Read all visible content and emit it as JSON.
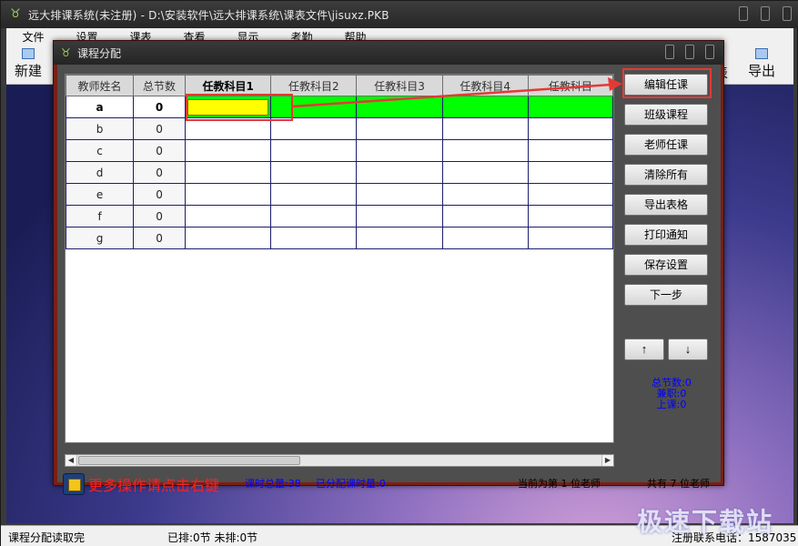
{
  "main_window": {
    "title": "远大排课系统(未注册) - D:\\安装软件\\远大排课系统\\课表文件\\jisuxz.PKB",
    "menu": [
      "文件",
      "设置",
      "课表",
      "查看",
      "显示",
      "考勤",
      "帮助"
    ],
    "toolbar": {
      "new_label": "新建",
      "table_label": "表",
      "export_label": "导出"
    }
  },
  "dialog": {
    "title": "课程分配",
    "grid": {
      "columns": [
        "教师姓名",
        "总节数",
        "任教科目1",
        "任教科目2",
        "任教科目3",
        "任教科目4",
        "任教科目"
      ],
      "rows": [
        {
          "name": "a",
          "count": "0"
        },
        {
          "name": "b",
          "count": "0"
        },
        {
          "name": "c",
          "count": "0"
        },
        {
          "name": "d",
          "count": "0"
        },
        {
          "name": "e",
          "count": "0"
        },
        {
          "name": "f",
          "count": "0"
        },
        {
          "name": "g",
          "count": "0"
        }
      ]
    },
    "buttons": [
      "编辑任课",
      "班级课程",
      "老师任课",
      "清除所有",
      "导出表格",
      "打印通知",
      "保存设置",
      "下一步"
    ],
    "arrows": {
      "up": "↑",
      "down": "↓"
    },
    "stats": {
      "total": "总节数:0",
      "parttime": "兼职:0",
      "class": "上课:0"
    },
    "footer": {
      "hint": "更多操作请点击右键",
      "total_hours": "课时总量:38",
      "assigned_hours": "已分配课时量:0",
      "current": "当前为第 1 位老师",
      "all": "共有 7 位老师"
    }
  },
  "statusbar": {
    "left": "课程分配读取完",
    "middle": "已排:0节 未排:0节",
    "right": "注册联系电话：1587035"
  },
  "watermark": "极速下载站",
  "colors": {
    "active_row": "#00ff00",
    "selected_cell": "#ffff00",
    "annotation": "#e53935"
  }
}
